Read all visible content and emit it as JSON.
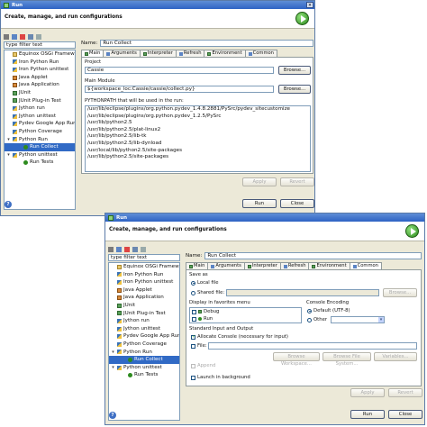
{
  "common": {
    "title": "Run",
    "banner": "Create, manage, and run configurations",
    "filter_placeholder": "type filter text",
    "name_label": "Name:",
    "name_value": "Run Collect",
    "tree": [
      {
        "label": "Equinox OSGi Framework",
        "icon": "osgi-icon",
        "level": 1
      },
      {
        "label": "Iron Python Run",
        "icon": "python-icon",
        "level": 1
      },
      {
        "label": "Iron Python unittest",
        "icon": "python-icon",
        "level": 1
      },
      {
        "label": "Java Applet",
        "icon": "java-icon",
        "level": 1
      },
      {
        "label": "Java Application",
        "icon": "java-icon",
        "level": 1
      },
      {
        "label": "JUnit",
        "icon": "junit-icon",
        "level": 1
      },
      {
        "label": "JUnit Plug-in Test",
        "icon": "junit-icon",
        "level": 1
      },
      {
        "label": "Jython run",
        "icon": "python-icon",
        "level": 1
      },
      {
        "label": "Jython unittest",
        "icon": "python-icon",
        "level": 1
      },
      {
        "label": "Pydev Google App Run",
        "icon": "python-icon",
        "level": 1
      },
      {
        "label": "Python Coverage",
        "icon": "python-icon",
        "level": 1
      },
      {
        "label": "Python Run",
        "icon": "python-icon",
        "level": 1,
        "expanded": true
      },
      {
        "label": "Run Collect",
        "icon": "run-icon",
        "level": 2,
        "selected": true
      },
      {
        "label": "Python unittest",
        "icon": "python-icon",
        "level": 1,
        "expanded": true
      },
      {
        "label": "Run Tests",
        "icon": "run-icon",
        "level": 2
      }
    ],
    "tabs": [
      {
        "label": "Main",
        "icon": "main-icon"
      },
      {
        "label": "Arguments",
        "icon": "arguments-icon"
      },
      {
        "label": "Interpreter",
        "icon": "interpreter-icon"
      },
      {
        "label": "Refresh",
        "icon": "refresh-icon"
      },
      {
        "label": "Environment",
        "icon": "environment-icon"
      },
      {
        "label": "Common",
        "icon": "common-icon"
      }
    ],
    "apply": "Apply",
    "revert": "Revert",
    "run": "Run",
    "close": "Close",
    "help": "?"
  },
  "window1": {
    "active_tab": "Main",
    "project_label": "Project",
    "project_value": "Cassie",
    "browse": "Browse...",
    "module_label": "Main Module",
    "module_value": "${workspace_loc:Cassie/cassie/collect.py}",
    "pythonpath_label": "PYTHONPATH that will be used in the run:",
    "pythonpath": [
      "/usr/lib/eclipse/plugins/org.python.pydev_1.4.8.2881/PySrc/pydev_sitecustomize",
      "/usr/lib/eclipse/plugins/org.python.pydev_1.2.5/PySrc",
      "/usr/lib/python2.5",
      "/usr/lib/python2.5/plat-linux2",
      "/usr/lib/python2.5/lib-tk",
      "/usr/lib/python2.5/lib-dynload",
      "/usr/local/lib/python2.5/site-packages",
      "/usr/lib/python2.5/site-packages"
    ]
  },
  "window2": {
    "active_tab": "Common",
    "save_as": "Save as",
    "local_file": "Local file",
    "shared_file": "Shared file:",
    "browse": "Browse...",
    "favorites_label": "Display in favorites menu",
    "favorites": [
      {
        "label": "Debug",
        "checked": false,
        "icon": "debug-icon"
      },
      {
        "label": "Run",
        "checked": false,
        "icon": "run-icon"
      }
    ],
    "console_encoding": "Console Encoding",
    "default_encoding": "Default (UTF-8)",
    "other": "Other",
    "std_io": "Standard Input and Output",
    "allocate_console": "Allocate Console (necessary for input)",
    "file_label": "File:",
    "browse_workspace": "Browse Workspace...",
    "browse_file_system": "Browse File System...",
    "variables": "Variables...",
    "append": "Append",
    "launch_background": "Launch in background"
  },
  "colors": {
    "title_bar": "#2e63c4",
    "selection": "#316ac5",
    "dialog_bg": "#ece9d8"
  }
}
